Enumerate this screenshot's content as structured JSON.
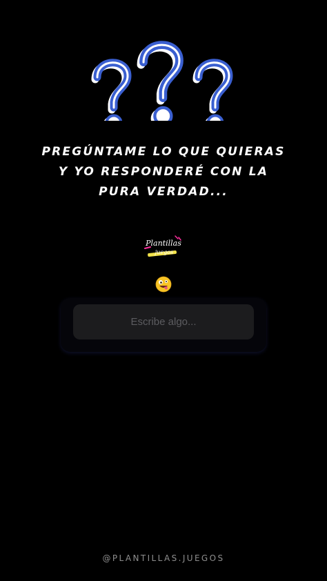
{
  "headline": {
    "line1": "PREGÚNTAME LO QUE QUIERAS",
    "line2": "Y YO RESPONDERÉ CON LA",
    "line3": "PURA VERDAD..."
  },
  "logo": {
    "text_top": "Plantillas",
    "text_bottom": "juegos"
  },
  "question_box": {
    "placeholder": "Escribe algo..."
  },
  "footer": {
    "handle": "@PLANTILLAS.JUEGOS"
  },
  "icons": {
    "question_marks": "question-marks-icon",
    "emoji": "zany-face-emoji"
  },
  "colors": {
    "background": "#000000",
    "question_mark_blue": "#3a5fd0",
    "input_bg": "#1c1c1e",
    "logo_pink": "#ff2fa0",
    "logo_yellow": "#f2e24a"
  }
}
